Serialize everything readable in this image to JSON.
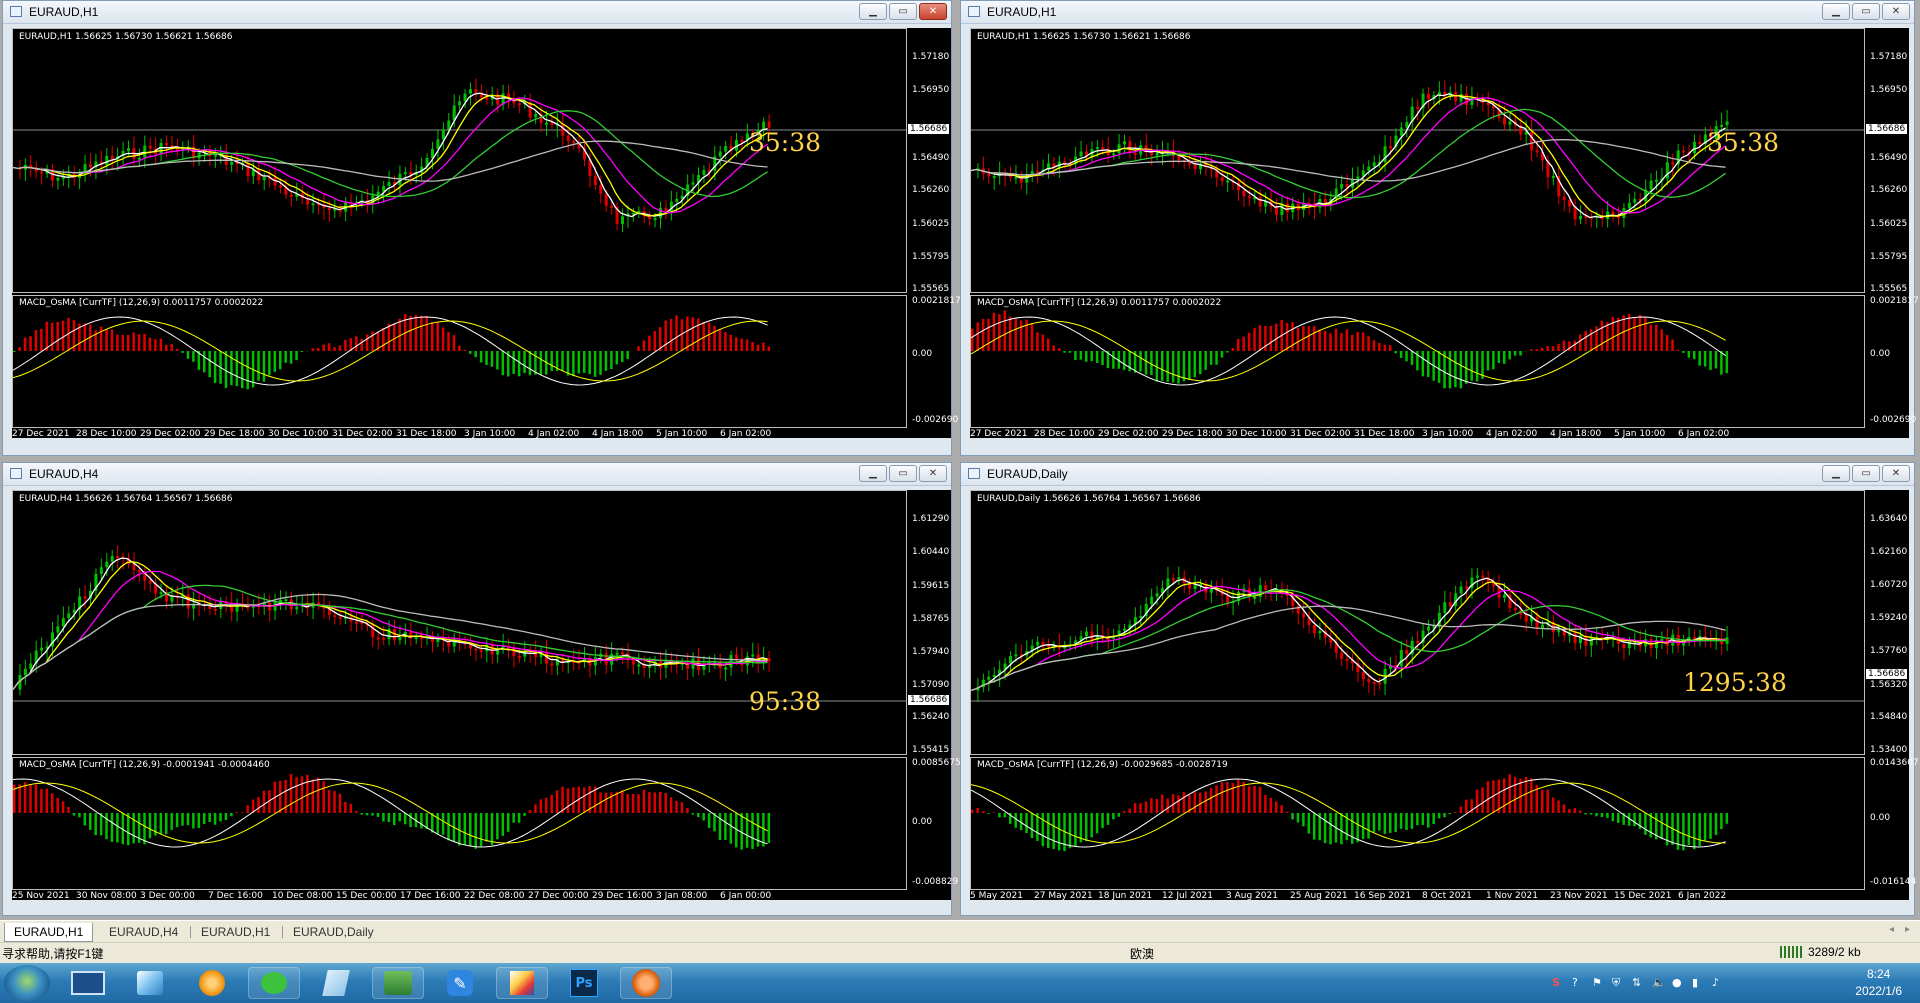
{
  "windows": [
    {
      "title": "EURAUD,H1",
      "info": "EURAUD,H1  1.56625 1.56730 1.56621 1.56686",
      "macd_label": "MACD_OsMA [CurrTF] (12,26,9) 0.0011757 0.0002022",
      "countdown": "35:38",
      "price_tag": "1.56686",
      "price_scale": [
        "1.57180",
        "1.56950",
        "1.56490",
        "1.56260",
        "1.56025",
        "1.55795",
        "1.55565"
      ],
      "macd_scale": [
        "0.0021817",
        "0.00",
        "-0.002690"
      ],
      "time_labels": [
        "27 Dec 2021",
        "28 Dec 10:00",
        "29 Dec 02:00",
        "29 Dec 18:00",
        "30 Dec 10:00",
        "31 Dec 02:00",
        "31 Dec 18:00",
        "3 Jan 10:00",
        "4 Jan 02:00",
        "4 Jan 18:00",
        "5 Jan 10:00",
        "6 Jan 02:00"
      ],
      "close_red": true
    },
    {
      "title": "EURAUD,H1",
      "info": "EURAUD,H1  1.56625 1.56730 1.56621 1.56686",
      "macd_label": "MACD_OsMA [CurrTF] (12,26,9) 0.0011757 0.0002022",
      "countdown": "35:38",
      "price_tag": "1.56686",
      "price_scale": [
        "1.57180",
        "1.56950",
        "1.56490",
        "1.56260",
        "1.56025",
        "1.55795",
        "1.55565"
      ],
      "macd_scale": [
        "0.0021817",
        "0.00",
        "-0.002690"
      ],
      "time_labels": [
        "27 Dec 2021",
        "28 Dec 10:00",
        "29 Dec 02:00",
        "29 Dec 18:00",
        "30 Dec 10:00",
        "31 Dec 02:00",
        "31 Dec 18:00",
        "3 Jan 10:00",
        "4 Jan 02:00",
        "4 Jan 18:00",
        "5 Jan 10:00",
        "6 Jan 02:00"
      ],
      "close_red": false
    },
    {
      "title": "EURAUD,H4",
      "info": "EURAUD,H4  1.56626 1.56764 1.56567 1.56686",
      "macd_label": "MACD_OsMA [CurrTF] (12,26,9) -0.0001941 -0.0004460",
      "countdown": "95:38",
      "price_tag": "1.56686",
      "price_scale": [
        "1.61290",
        "1.60440",
        "1.59615",
        "1.58765",
        "1.57940",
        "1.57090",
        "1.56240",
        "1.55415"
      ],
      "macd_scale": [
        "0.0085675",
        "0.00",
        "-0.008829"
      ],
      "time_labels": [
        "25 Nov 2021",
        "30 Nov 08:00",
        "3 Dec 00:00",
        "7 Dec 16:00",
        "10 Dec 08:00",
        "15 Dec 00:00",
        "17 Dec 16:00",
        "22 Dec 08:00",
        "27 Dec 00:00",
        "29 Dec 16:00",
        "3 Jan 08:00",
        "6 Jan 00:00"
      ],
      "close_red": false
    },
    {
      "title": "EURAUD,Daily",
      "info": "EURAUD,Daily  1.56626 1.56764 1.56567 1.56686",
      "macd_label": "MACD_OsMA [CurrTF] (12,26,9) -0.0029685 -0.0028719",
      "countdown": "1295:38",
      "price_tag": "1.56686",
      "price_scale": [
        "1.63640",
        "1.62160",
        "1.60720",
        "1.59240",
        "1.57760",
        "1.56320",
        "1.54840",
        "1.53400"
      ],
      "macd_scale": [
        "0.0143607",
        "0.00",
        "-0.016144"
      ],
      "time_labels": [
        "5 May 2021",
        "27 May 2021",
        "18 Jun 2021",
        "12 Jul 2021",
        "3 Aug 2021",
        "25 Aug 2021",
        "16 Sep 2021",
        "8 Oct 2021",
        "1 Nov 2021",
        "23 Nov 2021",
        "15 Dec 2021",
        "6 Jan 2022"
      ],
      "close_red": false
    }
  ],
  "tabs": [
    "EURAUD,H1",
    "EURAUD,H4",
    "EURAUD,H1",
    "EURAUD,Daily"
  ],
  "status": {
    "help": "寻求帮助,请按F1键",
    "profile": "欧澳",
    "traffic": "3289/2 kb"
  },
  "taskbar": {
    "apps": [
      "desktop",
      "control-panel",
      "browser",
      "wechat",
      "notes",
      "app-game",
      "pen",
      "paint",
      "photoshop",
      "mt4"
    ],
    "ps_label": "Ps",
    "time": "8:24",
    "date": "2022/1/6"
  },
  "colors": {
    "bull": "#00c000",
    "bear": "#e00000",
    "ma_white": "#ffffff",
    "ma_yellow": "#ffff00",
    "ma_magenta": "#ff00ff",
    "ma_green": "#33cc33",
    "ma_gray": "#bbbbbb",
    "countdown": "#ffd24a"
  }
}
